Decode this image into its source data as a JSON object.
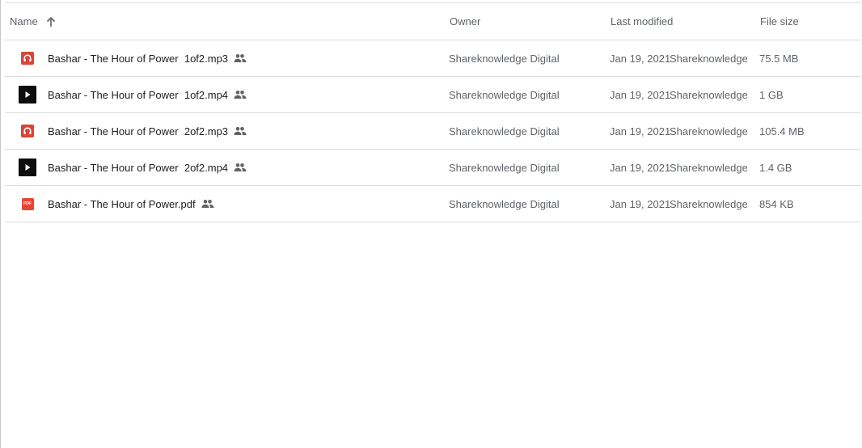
{
  "header": {
    "name_label": "Name",
    "owner_label": "Owner",
    "modified_label": "Last modified",
    "size_label": "File size"
  },
  "files": [
    {
      "name": "Bashar - The Hour of Power  1of2.mp3",
      "type_icon": "audio-file-icon",
      "owner": "Shareknowledge Digital",
      "modified_date": "Jan 19, 2021",
      "modified_by": "Shareknowledge ...",
      "size": "75.5 MB"
    },
    {
      "name": "Bashar - The Hour of Power  1of2.mp4",
      "type_icon": "video-file-icon",
      "owner": "Shareknowledge Digital",
      "modified_date": "Jan 19, 2021",
      "modified_by": "Shareknowledge ...",
      "size": "1 GB"
    },
    {
      "name": "Bashar - The Hour of Power  2of2.mp3",
      "type_icon": "audio-file-icon",
      "owner": "Shareknowledge Digital",
      "modified_date": "Jan 19, 2021",
      "modified_by": "Shareknowledge ...",
      "size": "105.4 MB"
    },
    {
      "name": "Bashar - The Hour of Power  2of2.mp4",
      "type_icon": "video-file-icon",
      "owner": "Shareknowledge Digital",
      "modified_date": "Jan 19, 2021",
      "modified_by": "Shareknowledge ...",
      "size": "1.4 GB"
    },
    {
      "name": "Bashar - The Hour of Power.pdf",
      "type_icon": "pdf-file-icon",
      "pdf_badge": "PDF",
      "owner": "Shareknowledge Digital",
      "modified_date": "Jan 19, 2021",
      "modified_by": "Shareknowledge ...",
      "size": "854 KB"
    }
  ],
  "colors": {
    "audio_icon": "#db4437",
    "video_icon": "#0d0d0d",
    "pdf_icon": "#ea4335",
    "secondary_text": "#5f6368",
    "divider": "#dadce0"
  }
}
